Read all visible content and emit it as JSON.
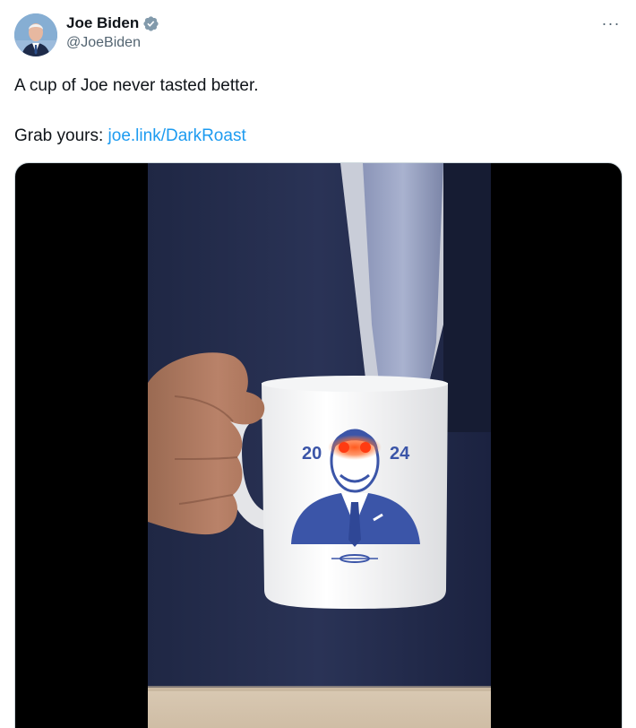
{
  "author": {
    "display_name": "Joe Biden",
    "handle": "@JoeBiden",
    "verified": true,
    "avatar_icon": "profile-photo",
    "verified_color": "#829aab"
  },
  "menu": {
    "more_label": "···"
  },
  "tweet": {
    "text_line1": "A cup of Joe never tasted better.",
    "text_line2_prefix": "Grab yours: ",
    "link_text": "joe.link/DarkRoast",
    "link_color": "#1d9bf0"
  },
  "media": {
    "type": "video",
    "mug": {
      "text_left": "20",
      "text_right": "24"
    }
  }
}
